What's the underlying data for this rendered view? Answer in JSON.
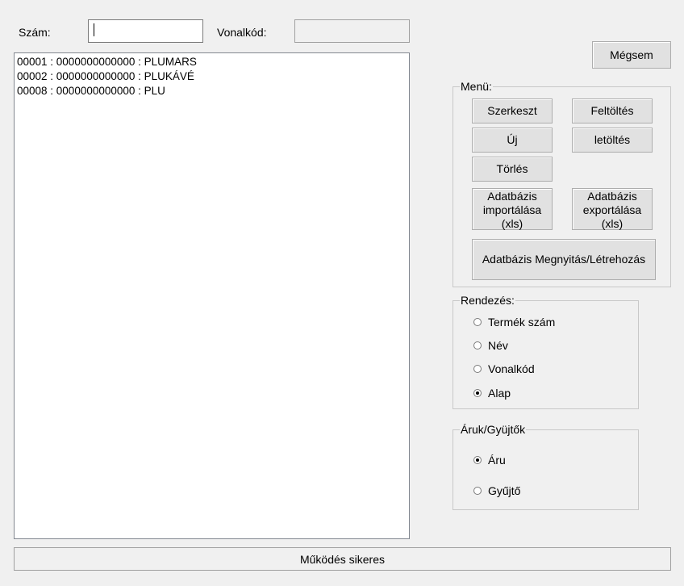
{
  "search": {
    "szam_label": "Szám:",
    "szam_value": "",
    "vonalkod_label": "Vonalkód:",
    "vonalkod_value": ""
  },
  "list": {
    "items": [
      "00001 : 0000000000000 : PLUMARS",
      "00002 : 0000000000000 : PLUKÁVÉ",
      "00008 : 0000000000000 : PLU"
    ]
  },
  "buttons": {
    "cancel": "Mégsem"
  },
  "menu": {
    "title": "Menü:",
    "edit": "Szerkeszt",
    "upload": "Feltöltés",
    "new": "Új",
    "download": "letöltés",
    "delete": "Törlés",
    "import": "Adatbázis\nimportálása\n(xls)",
    "export": "Adatbázis\nexportálása\n(xls)",
    "open_create": "Adatbázis Megnyitás/Létrehozás"
  },
  "sort": {
    "title": "Rendezés:",
    "options": [
      "Termék szám",
      "Név",
      "Vonalkód",
      "Alap"
    ],
    "selected": "Alap"
  },
  "type": {
    "title": "Áruk/Gyüjtők",
    "options": [
      "Áru",
      "Gyűjtő"
    ],
    "selected": "Áru"
  },
  "status": {
    "text": "Működés sikeres"
  }
}
